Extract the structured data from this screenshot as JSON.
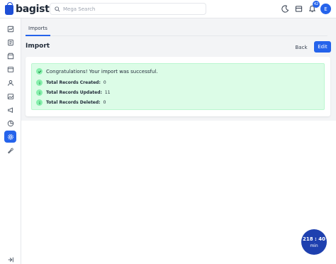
{
  "header": {
    "brand": "bagisto",
    "search_placeholder": "Mega Search",
    "notification_count": "42",
    "avatar_initial": "E"
  },
  "tabs": [
    {
      "label": "Imports"
    }
  ],
  "page": {
    "title": "Import",
    "back_label": "Back",
    "edit_label": "Edit"
  },
  "alert": {
    "message": "Congratulations! Your import was successful.",
    "stats": [
      {
        "label": "Total Records Created:",
        "value": "0"
      },
      {
        "label": "Total Records Updated:",
        "value": "11"
      },
      {
        "label": "Total Records Deleted:",
        "value": "0"
      }
    ]
  },
  "timer": {
    "time": "218 : 40",
    "unit": "min"
  },
  "colors": {
    "accent": "#2563eb",
    "success_bg": "#dcfce7",
    "timer_bg": "#1e40af"
  },
  "sidebar_icons": [
    "dashboard-icon",
    "sales-icon",
    "catalog-icon",
    "customers-icon",
    "cms-icon",
    "marketing-icon",
    "reporting-icon",
    "settings-icon",
    "configure-icon",
    "collapse-icon"
  ]
}
